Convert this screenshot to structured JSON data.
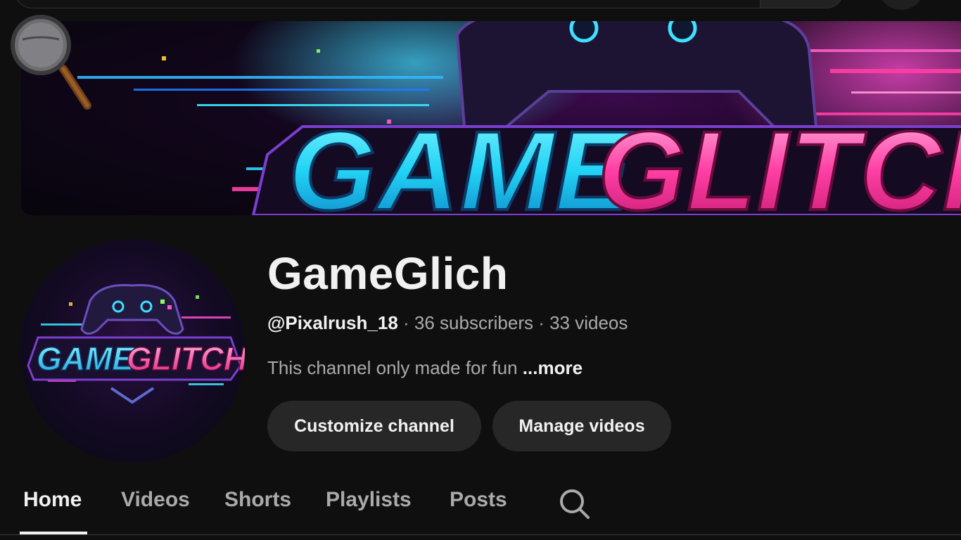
{
  "banner": {
    "brand_left": "GAME",
    "brand_right": "GLITCH"
  },
  "avatar": {
    "brand_left": "GAME",
    "brand_right": "GLITCH"
  },
  "channel": {
    "name": "GameGlich",
    "handle": "@Pixalrush_18",
    "subscribers": "36 subscribers",
    "videos": "33 videos",
    "separator": " · ",
    "description": "This channel only made for fun",
    "more_label": "...more"
  },
  "actions": {
    "customize_label": "Customize channel",
    "manage_label": "Manage videos"
  },
  "tabs": [
    {
      "label": "Home",
      "active": true
    },
    {
      "label": "Videos",
      "active": false
    },
    {
      "label": "Shorts",
      "active": false
    },
    {
      "label": "Playlists",
      "active": false
    },
    {
      "label": "Posts",
      "active": false
    }
  ],
  "icons": {
    "tab_search": "search-icon",
    "cursor": "magnifier-icon"
  },
  "colors": {
    "background": "#0f0f0f",
    "text_primary": "#f1f1f1",
    "text_secondary": "#aaaaaa",
    "button_bg": "#272727",
    "brand_cyan": "#22d3f5",
    "brand_pink": "#ff3fa4"
  }
}
